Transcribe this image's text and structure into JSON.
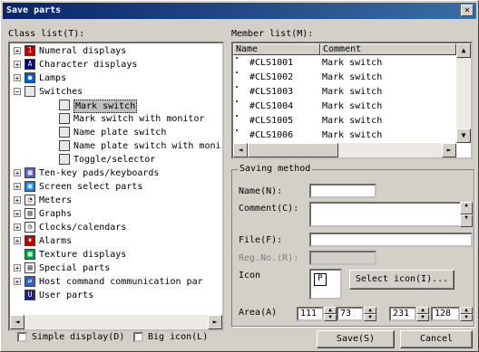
{
  "window": {
    "title": "Save parts",
    "close_glyph": "×"
  },
  "class_list": {
    "label": "Class list(T):",
    "items": [
      {
        "label": "Numeral displays",
        "icon": "numeral-display-icon",
        "expander": "+",
        "level": 0
      },
      {
        "label": "Character displays",
        "icon": "character-display-icon",
        "expander": "+",
        "level": 0
      },
      {
        "label": "Lamps",
        "icon": "lamp-icon",
        "expander": "+",
        "level": 0
      },
      {
        "label": "Switches",
        "icon": "switch-icon",
        "expander": "−",
        "level": 0
      },
      {
        "label": "Mark switch",
        "icon": "switch-icon",
        "expander": "",
        "level": 1,
        "selected": true
      },
      {
        "label": "Mark switch with monitor",
        "icon": "switch-icon",
        "expander": "",
        "level": 1
      },
      {
        "label": "Name plate switch",
        "icon": "switch-icon",
        "expander": "",
        "level": 1
      },
      {
        "label": "Name plate switch with moni",
        "icon": "switch-icon",
        "expander": "",
        "level": 1
      },
      {
        "label": "Toggle/selector",
        "icon": "switch-icon",
        "expander": "",
        "level": 1
      },
      {
        "label": "Ten-key pads/keyboards",
        "icon": "keypad-icon",
        "expander": "+",
        "level": 0
      },
      {
        "label": "Screen select parts",
        "icon": "screen-select-icon",
        "expander": "+",
        "level": 0
      },
      {
        "label": "Meters",
        "icon": "meter-icon",
        "expander": "+",
        "level": 0
      },
      {
        "label": "Graphs",
        "icon": "graph-icon",
        "expander": "+",
        "level": 0
      },
      {
        "label": "Clocks/calendars",
        "icon": "clock-icon",
        "expander": "+",
        "level": 0
      },
      {
        "label": "Alarms",
        "icon": "alarm-icon",
        "expander": "+",
        "level": 0
      },
      {
        "label": "Texture displays",
        "icon": "texture-icon",
        "expander": "",
        "level": 0
      },
      {
        "label": "Special parts",
        "icon": "special-parts-icon",
        "expander": "+",
        "level": 0
      },
      {
        "label": "Host command communication par",
        "icon": "host-command-icon",
        "expander": "+",
        "level": 0
      },
      {
        "label": "User parts",
        "icon": "user-parts-icon",
        "expander": "",
        "level": 0
      }
    ]
  },
  "member_list": {
    "label": "Member list(M):",
    "columns": [
      "Name",
      "Comment"
    ],
    "rows": [
      {
        "name": "#CLS1001",
        "comment": "Mark switch"
      },
      {
        "name": "#CLS1002",
        "comment": "Mark switch"
      },
      {
        "name": "#CLS1003",
        "comment": "Mark switch"
      },
      {
        "name": "#CLS1004",
        "comment": "Mark switch"
      },
      {
        "name": "#CLS1005",
        "comment": "Mark switch"
      },
      {
        "name": "#CLS1006",
        "comment": "Mark switch"
      }
    ]
  },
  "saving_method": {
    "title": "Saving method",
    "name_label": "Name(N):",
    "name_value": "",
    "comment_label": "Comment(C):",
    "comment_value": "",
    "file_label": "File(F):",
    "file_value": "",
    "reg_no_label": "Reg.No.(R):",
    "reg_no_value": "",
    "icon_label": "Icon",
    "icon_preview": "P",
    "select_icon_label": "Select icon(I)...",
    "area_label": "Area(A)",
    "area_values": [
      "111",
      "73",
      "231",
      "128"
    ]
  },
  "options": {
    "simple_display_label": "Simple display(D)",
    "big_icon_label": "Big icon(L)"
  },
  "buttons": {
    "save_label": "Save(S)",
    "cancel_label": "Cancel"
  },
  "colors": {
    "title_start": "#0a246a",
    "title_end": "#3a6ea5",
    "face": "#d4d0c8",
    "selection": "#c0c0c0"
  }
}
